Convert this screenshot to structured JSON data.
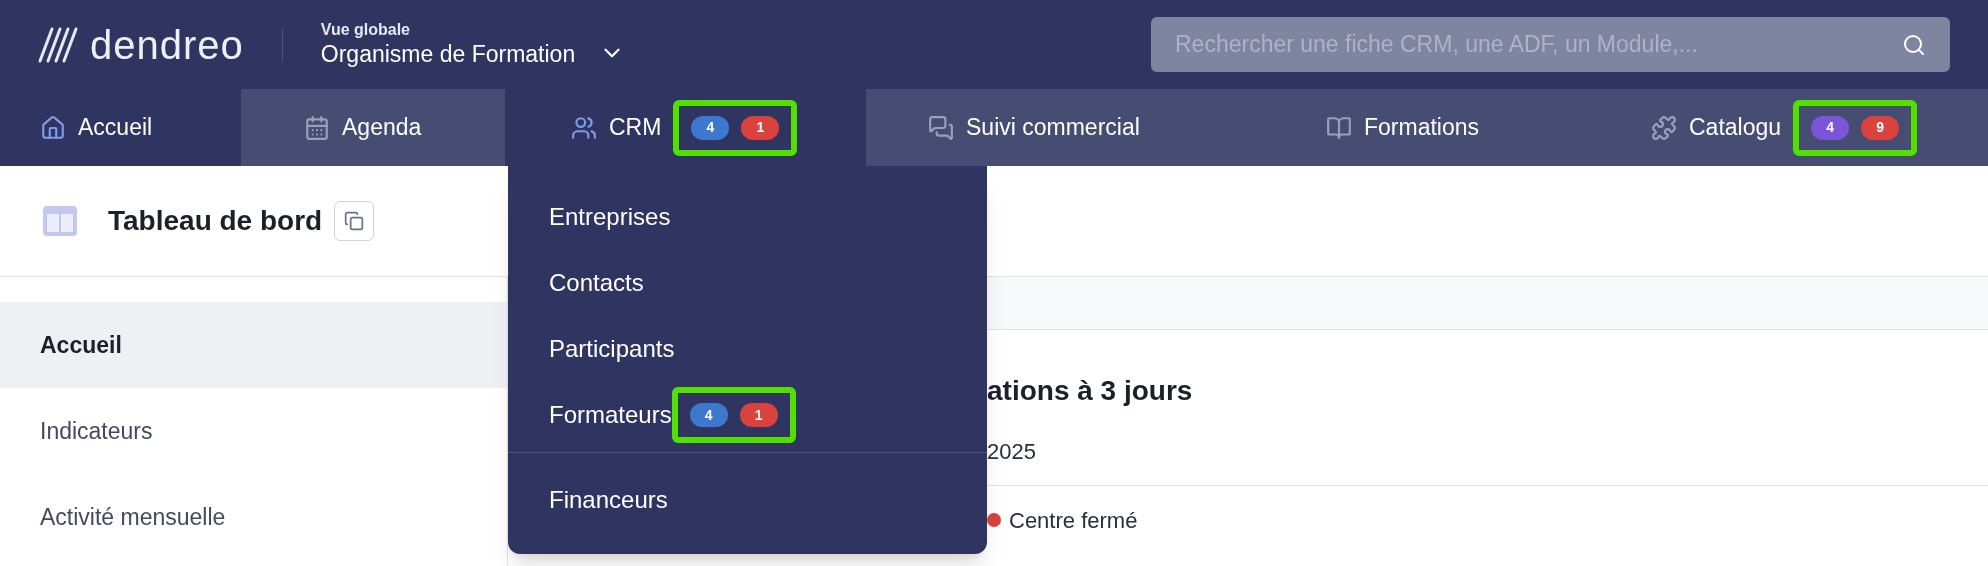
{
  "header": {
    "logo": "dendreo",
    "context_label": "Vue globale",
    "context_value": "Organisme de Formation",
    "search": {
      "placeholder": "Rechercher une fiche CRM, une ADF, un Module,..."
    }
  },
  "nav_tabs": [
    {
      "label": "Accueil",
      "selected": true
    },
    {
      "label": "Agenda",
      "selected": false
    },
    {
      "label": "CRM",
      "selected": true,
      "highlighted": true,
      "badges": [
        {
          "text": "4",
          "color": "#3d78cf"
        },
        {
          "text": "1",
          "color": "#d8433e"
        }
      ]
    },
    {
      "label": "Suivi commercial",
      "selected": false
    },
    {
      "label": "Formations",
      "selected": false
    },
    {
      "label": "Catalogu",
      "selected": false,
      "highlighted": true,
      "badges": [
        {
          "text": "4",
          "color": "#7a55d8"
        },
        {
          "text": "9",
          "color": "#d8433e"
        }
      ]
    }
  ],
  "dropdown": {
    "groups": [
      [
        {
          "label": "Entreprises"
        },
        {
          "label": "Contacts"
        },
        {
          "label": "Participants"
        },
        {
          "label": "Formateurs",
          "highlighted": true,
          "badges": [
            {
              "text": "4",
              "color": "#3d78cf"
            },
            {
              "text": "1",
              "color": "#d8433e"
            }
          ]
        }
      ],
      [
        {
          "label": "Financeurs"
        }
      ]
    ]
  },
  "page": {
    "title": "Tableau de bord"
  },
  "sidebar": {
    "items": [
      {
        "label": "Accueil",
        "selected": true
      },
      {
        "label": "Indicateurs",
        "selected": false
      },
      {
        "label": "Activité mensuelle",
        "selected": false
      }
    ]
  },
  "main": {
    "heading": "ations à 3 jours",
    "rows": [
      {
        "text": "2025"
      },
      {
        "text": "Centre fermé",
        "color": "#d8433e"
      }
    ]
  }
}
